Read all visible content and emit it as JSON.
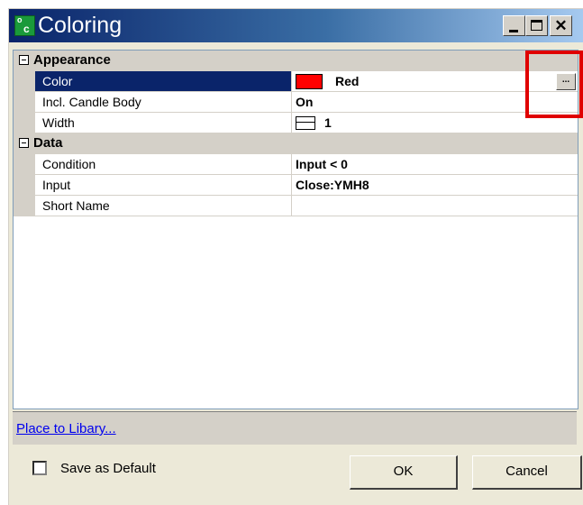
{
  "window": {
    "title": "Coloring",
    "icon": "app-icon",
    "controls": [
      "minimize-icon",
      "maximize-icon",
      "close-icon"
    ]
  },
  "property_grid": {
    "categories": [
      {
        "label": "Appearance",
        "toggle": "−",
        "properties": [
          {
            "name": "Color",
            "value": "Red",
            "selected": true,
            "swatch_color": "#ff0000",
            "editor_button": "..."
          },
          {
            "name": "Incl. Candle Body",
            "value": "On"
          },
          {
            "name": "Width",
            "value": "1",
            "icon": "line-width-icon"
          }
        ]
      },
      {
        "label": "Data",
        "toggle": "−",
        "properties": [
          {
            "name": "Condition",
            "value": "Input < 0"
          },
          {
            "name": "Input",
            "value": "Close:YMH8"
          },
          {
            "name": "Short Name",
            "value": ""
          }
        ]
      }
    ]
  },
  "link_bar": {
    "link_label": "Place to Libary..."
  },
  "footer": {
    "save_default_label": "Save as Default",
    "save_default_checked": false,
    "ok_label": "OK",
    "cancel_label": "Cancel"
  },
  "colors": {
    "titlebar_start": "#0a246a",
    "titlebar_end": "#a6caf0",
    "selected_row": "#0a246a",
    "highlight_box": "#e00000",
    "swatch": "#ff0000"
  }
}
